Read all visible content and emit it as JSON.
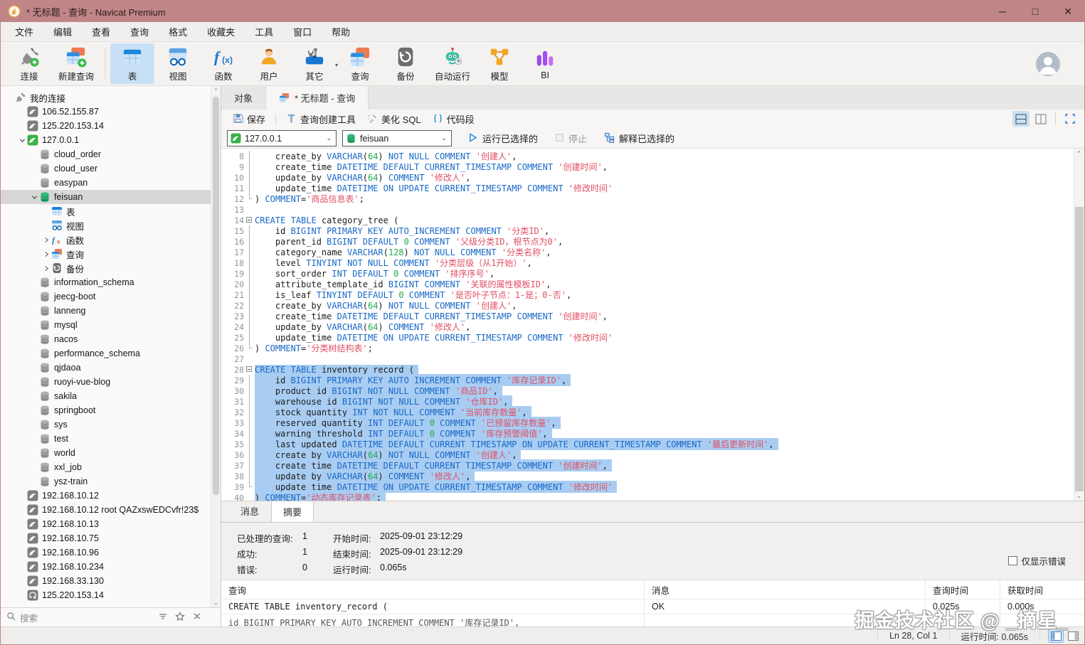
{
  "window": {
    "title": "* 无标题 - 查询 - Navicat Premium",
    "controls": {
      "minimize": "─",
      "maximize": "□",
      "close": "✕"
    }
  },
  "colors": {
    "titlebar": "#c08687",
    "keyword": "#1868c8",
    "number": "#1faa4e",
    "string": "#e14f63",
    "selection": "#a9cdf2",
    "toolbar_active": "#c7e0f6"
  },
  "menu": {
    "items": [
      "文件",
      "编辑",
      "查看",
      "查询",
      "格式",
      "收藏夹",
      "工具",
      "窗口",
      "帮助"
    ]
  },
  "toolbar": {
    "buttons": [
      {
        "label": "连接",
        "icon": "connection-icon"
      },
      {
        "label": "新建查询",
        "icon": "new-query-icon"
      },
      {
        "label": "表",
        "icon": "table-icon",
        "active": true
      },
      {
        "label": "视图",
        "icon": "view-icon"
      },
      {
        "label": "函数",
        "icon": "function-icon"
      },
      {
        "label": "用户",
        "icon": "user-icon"
      },
      {
        "label": "其它",
        "icon": "other-icon",
        "dropdown": true
      },
      {
        "label": "查询",
        "icon": "query-icon"
      },
      {
        "label": "备份",
        "icon": "backup-icon"
      },
      {
        "label": "自动运行",
        "icon": "automation-icon"
      },
      {
        "label": "模型",
        "icon": "model-icon"
      },
      {
        "label": "BI",
        "icon": "bi-icon"
      }
    ]
  },
  "sidebar": {
    "search_placeholder": "搜索",
    "tree": [
      {
        "label": "我的连接",
        "icon": "connections-group-icon",
        "level": 0
      },
      {
        "label": "106.52.155.87",
        "icon": "mysql-connection-icon",
        "level": 1
      },
      {
        "label": "125.220.153.14",
        "icon": "mysql-connection-icon",
        "level": 1
      },
      {
        "label": "127.0.0.1",
        "icon": "mysql-connection-open-icon",
        "level": 1,
        "expander": "down"
      },
      {
        "label": "cloud_order",
        "icon": "database-icon",
        "level": 2
      },
      {
        "label": "cloud_user",
        "icon": "database-icon",
        "level": 2
      },
      {
        "label": "easypan",
        "icon": "database-icon",
        "level": 2
      },
      {
        "label": "feisuan",
        "icon": "database-open-icon",
        "level": 2,
        "expander": "down",
        "selected": true
      },
      {
        "label": "表",
        "icon": "table-small-icon",
        "level": 3
      },
      {
        "label": "视图",
        "icon": "view-small-icon",
        "level": 3
      },
      {
        "label": "函数",
        "icon": "function-small-icon",
        "level": 3,
        "expander": "right"
      },
      {
        "label": "查询",
        "icon": "query-small-icon",
        "level": 3,
        "expander": "right"
      },
      {
        "label": "备份",
        "icon": "backup-small-icon",
        "level": 3,
        "expander": "right"
      },
      {
        "label": "information_schema",
        "icon": "database-icon",
        "level": 2
      },
      {
        "label": "jeecg-boot",
        "icon": "database-icon",
        "level": 2
      },
      {
        "label": "lanneng",
        "icon": "database-icon",
        "level": 2
      },
      {
        "label": "mysql",
        "icon": "database-icon",
        "level": 2
      },
      {
        "label": "nacos",
        "icon": "database-icon",
        "level": 2
      },
      {
        "label": "performance_schema",
        "icon": "database-icon",
        "level": 2
      },
      {
        "label": "qjdaoa",
        "icon": "database-icon",
        "level": 2
      },
      {
        "label": "ruoyi-vue-blog",
        "icon": "database-icon",
        "level": 2
      },
      {
        "label": "sakila",
        "icon": "database-icon",
        "level": 2
      },
      {
        "label": "springboot",
        "icon": "database-icon",
        "level": 2
      },
      {
        "label": "sys",
        "icon": "database-icon",
        "level": 2
      },
      {
        "label": "test",
        "icon": "database-icon",
        "level": 2
      },
      {
        "label": "world",
        "icon": "database-icon",
        "level": 2
      },
      {
        "label": "xxl_job",
        "icon": "database-icon",
        "level": 2
      },
      {
        "label": "ysz-train",
        "icon": "database-icon",
        "level": 2
      },
      {
        "label": "192.168.10.12",
        "icon": "mysql-connection-icon",
        "level": 1
      },
      {
        "label": "192.168.10.12 root QAZxswEDCvfr!23$",
        "icon": "mysql-connection-icon",
        "level": 1
      },
      {
        "label": "192.168.10.13",
        "icon": "mysql-connection-icon",
        "level": 1
      },
      {
        "label": "192.168.10.75",
        "icon": "mysql-connection-icon",
        "level": 1
      },
      {
        "label": "192.168.10.96",
        "icon": "mysql-connection-icon",
        "level": 1
      },
      {
        "label": "192.168.10.234",
        "icon": "mysql-connection-icon",
        "level": 1
      },
      {
        "label": "192.168.33.130",
        "icon": "mysql-connection-icon",
        "level": 1
      },
      {
        "label": "125.220.153.14",
        "icon": "postgres-connection-icon",
        "level": 1
      }
    ]
  },
  "tabs": {
    "items": [
      {
        "label": "对象",
        "active": false
      },
      {
        "label": "* 无标题 - 查询",
        "icon": "query-small-icon",
        "active": true
      }
    ]
  },
  "query_toolbar": {
    "save": "保存",
    "builder": "查询创建工具",
    "beautify": "美化 SQL",
    "snippet": "代码段"
  },
  "run_bar": {
    "connection": "127.0.0.1",
    "database": "feisuan",
    "run": "运行已选择的",
    "stop": "停止",
    "explain": "解释已选择的"
  },
  "editor": {
    "lines": [
      {
        "n": 8,
        "fold": "mid",
        "sel": false,
        "text": "    create_by VARCHAR(64) NOT NULL COMMENT '创建人',"
      },
      {
        "n": 9,
        "fold": "mid",
        "sel": false,
        "text": "    create_time DATETIME DEFAULT CURRENT_TIMESTAMP COMMENT '创建时间',"
      },
      {
        "n": 10,
        "fold": "mid",
        "sel": false,
        "text": "    update_by VARCHAR(64) COMMENT '修改人',"
      },
      {
        "n": 11,
        "fold": "mid",
        "sel": false,
        "text": "    update_time DATETIME ON UPDATE CURRENT_TIMESTAMP COMMENT '修改时间'"
      },
      {
        "n": 12,
        "fold": "end",
        "sel": false,
        "text": ") COMMENT='商品信息表';"
      },
      {
        "n": 13,
        "fold": null,
        "sel": false,
        "text": ""
      },
      {
        "n": 14,
        "fold": "start",
        "sel": false,
        "text": "CREATE TABLE category_tree ("
      },
      {
        "n": 15,
        "fold": "mid",
        "sel": false,
        "text": "    id BIGINT PRIMARY KEY AUTO_INCREMENT COMMENT '分类ID',"
      },
      {
        "n": 16,
        "fold": "mid",
        "sel": false,
        "text": "    parent_id BIGINT DEFAULT 0 COMMENT '父级分类ID，根节点为0',"
      },
      {
        "n": 17,
        "fold": "mid",
        "sel": false,
        "text": "    category_name VARCHAR(128) NOT NULL COMMENT '分类名称',"
      },
      {
        "n": 18,
        "fold": "mid",
        "sel": false,
        "text": "    level TINYINT NOT NULL COMMENT '分类层级（从1开始）',"
      },
      {
        "n": 19,
        "fold": "mid",
        "sel": false,
        "text": "    sort_order INT DEFAULT 0 COMMENT '排序序号',"
      },
      {
        "n": 20,
        "fold": "mid",
        "sel": false,
        "text": "    attribute_template_id BIGINT COMMENT '关联的属性模板ID',"
      },
      {
        "n": 21,
        "fold": "mid",
        "sel": false,
        "text": "    is_leaf TINYINT DEFAULT 0 COMMENT '是否叶子节点：1-是；0-否',"
      },
      {
        "n": 22,
        "fold": "mid",
        "sel": false,
        "text": "    create_by VARCHAR(64) NOT NULL COMMENT '创建人',"
      },
      {
        "n": 23,
        "fold": "mid",
        "sel": false,
        "text": "    create_time DATETIME DEFAULT CURRENT_TIMESTAMP COMMENT '创建时间',"
      },
      {
        "n": 24,
        "fold": "mid",
        "sel": false,
        "text": "    update_by VARCHAR(64) COMMENT '修改人',"
      },
      {
        "n": 25,
        "fold": "mid",
        "sel": false,
        "text": "    update_time DATETIME ON UPDATE CURRENT_TIMESTAMP COMMENT '修改时间'"
      },
      {
        "n": 26,
        "fold": "end",
        "sel": false,
        "text": ") COMMENT='分类树结构表';"
      },
      {
        "n": 27,
        "fold": null,
        "sel": false,
        "text": ""
      },
      {
        "n": 28,
        "fold": "start",
        "sel": true,
        "text": "CREATE TABLE inventory_record ("
      },
      {
        "n": 29,
        "fold": "mid",
        "sel": true,
        "text": "    id BIGINT PRIMARY KEY AUTO_INCREMENT COMMENT '库存记录ID',"
      },
      {
        "n": 30,
        "fold": "mid",
        "sel": true,
        "text": "    product_id BIGINT NOT NULL COMMENT '商品ID',"
      },
      {
        "n": 31,
        "fold": "mid",
        "sel": true,
        "text": "    warehouse_id BIGINT NOT NULL COMMENT '仓库ID',"
      },
      {
        "n": 32,
        "fold": "mid",
        "sel": true,
        "text": "    stock_quantity INT NOT NULL COMMENT '当前库存数量',"
      },
      {
        "n": 33,
        "fold": "mid",
        "sel": true,
        "text": "    reserved_quantity INT DEFAULT 0 COMMENT '已预留库存数量',"
      },
      {
        "n": 34,
        "fold": "mid",
        "sel": true,
        "text": "    warning_threshold INT DEFAULT 0 COMMENT '库存预警阈值',"
      },
      {
        "n": 35,
        "fold": "mid",
        "sel": true,
        "text": "    last_updated DATETIME DEFAULT CURRENT_TIMESTAMP ON UPDATE CURRENT_TIMESTAMP COMMENT '最后更新时间',"
      },
      {
        "n": 36,
        "fold": "mid",
        "sel": true,
        "text": "    create_by VARCHAR(64) NOT NULL COMMENT '创建人',"
      },
      {
        "n": 37,
        "fold": "mid",
        "sel": true,
        "text": "    create_time DATETIME DEFAULT CURRENT_TIMESTAMP COMMENT '创建时间',"
      },
      {
        "n": 38,
        "fold": "mid",
        "sel": true,
        "text": "    update_by VARCHAR(64) COMMENT '修改人',"
      },
      {
        "n": 39,
        "fold": "end",
        "sel": true,
        "text": "    update_time DATETIME ON UPDATE CURRENT_TIMESTAMP COMMENT '修改时间'"
      },
      {
        "n": 40,
        "fold": null,
        "sel": true,
        "text": ") COMMENT='动态库存记录表';"
      }
    ]
  },
  "bottom_panel": {
    "tabs": [
      {
        "label": "消息",
        "active": false
      },
      {
        "label": "摘要",
        "active": true
      }
    ],
    "summary": {
      "col1": [
        {
          "label": "已处理的查询:",
          "value": "1"
        },
        {
          "label": "成功:",
          "value": "1"
        },
        {
          "label": "错误:",
          "value": "0"
        }
      ],
      "col2": [
        {
          "label": "开始时间:",
          "value": "2025-09-01 23:12:29"
        },
        {
          "label": "结束时间:",
          "value": "2025-09-01 23:12:29"
        },
        {
          "label": "运行时间:",
          "value": "0.065s"
        }
      ]
    },
    "only_errors_label": "仅显示错误",
    "grid": {
      "columns": [
        "查询",
        "消息",
        "查询时间",
        "获取时间"
      ],
      "rows": [
        {
          "cells": [
            "CREATE TABLE inventory_record (",
            "OK",
            "0.025s",
            "0.000s"
          ],
          "clipped": false
        },
        {
          "cells": [
            "    id BIGINT PRIMARY KEY AUTO_INCREMENT COMMENT '库存记录ID',",
            "",
            "",
            ""
          ],
          "clipped": true
        }
      ]
    }
  },
  "status_bar": {
    "position": "Ln 28, Col 1",
    "runtime": "运行时间: 0.065s"
  },
  "watermark": "掘金技术社区 @ _摘星_"
}
